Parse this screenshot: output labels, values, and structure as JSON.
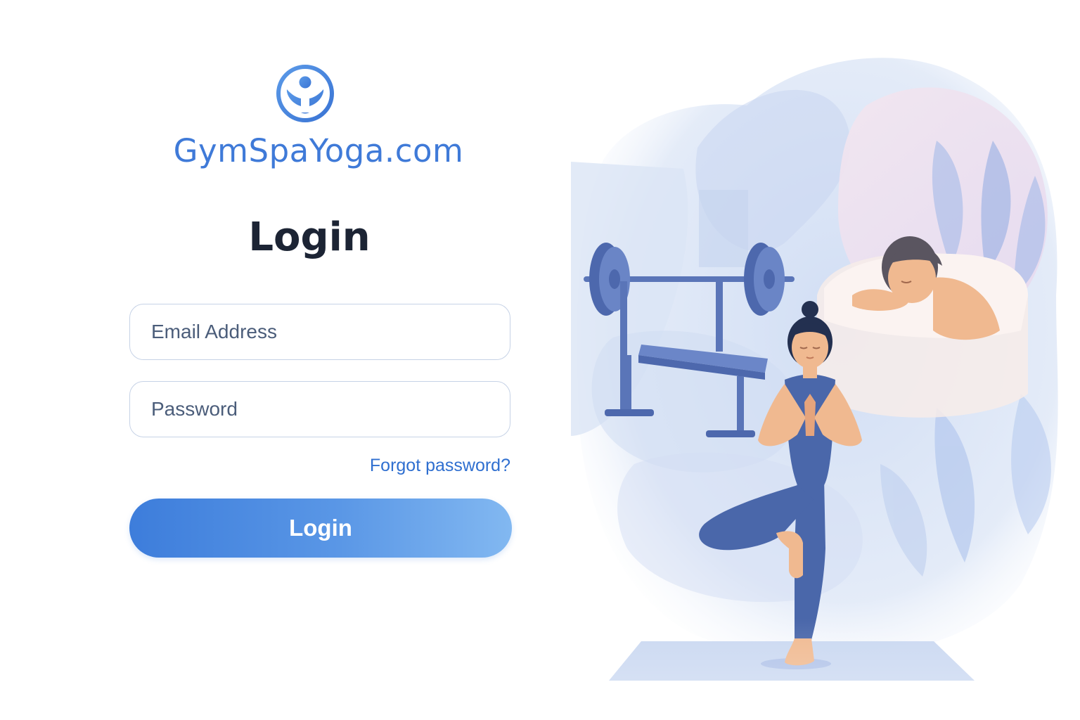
{
  "brand": {
    "logo": "person-arms-raised-circle-icon",
    "name": "GymSpaYoga.com",
    "color": "#3f7ad8"
  },
  "login_form": {
    "title": "Login",
    "email_placeholder": "Email Address",
    "password_placeholder": "Password",
    "forgot_password_label": "Forgot password?",
    "submit_label": "Login"
  },
  "illustration": {
    "subjects": [
      "barbell-bench-icon",
      "spa-massage-person-icon",
      "yoga-tree-pose-person-icon",
      "yoga-mat-icon",
      "leaves-icon"
    ]
  },
  "colors": {
    "accent": "#3d7ddb",
    "accent_light": "#82b8f1",
    "title": "#1c2434",
    "link": "#2f6fd0",
    "field_border": "#c6d2e6"
  }
}
